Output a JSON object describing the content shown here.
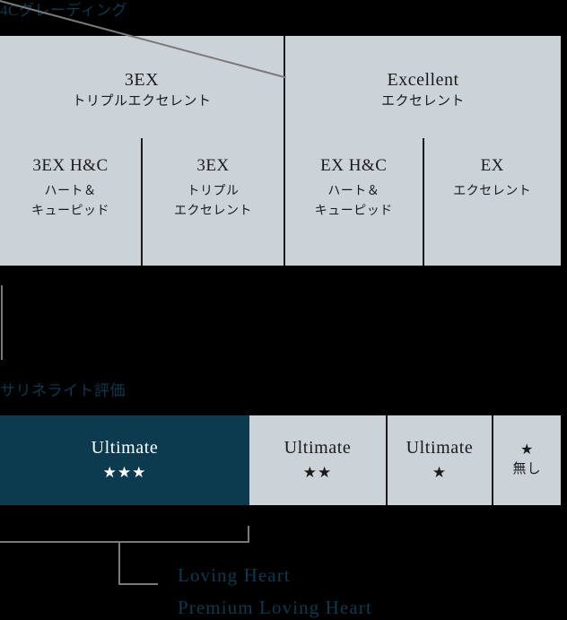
{
  "sections": {
    "grading": {
      "heading": "4Cグレーディング",
      "groups": [
        {
          "en": "3EX",
          "jp": "トリプルエクセレント",
          "cells": [
            {
              "en": "3EX H&C",
              "jp_line1": "ハート＆",
              "jp_line2": "キューピッド"
            },
            {
              "en": "3EX",
              "jp_line1": "トリプル",
              "jp_line2": "エクセレント"
            }
          ]
        },
        {
          "en": "Excellent",
          "jp": "エクセレント",
          "cells": [
            {
              "en": "EX H&C",
              "jp_line1": "ハート＆",
              "jp_line2": "キューピッド"
            },
            {
              "en": "EX",
              "jp_line1": "エクセレント",
              "jp_line2": ""
            }
          ]
        }
      ]
    },
    "sarine": {
      "heading": "サリネライト評価",
      "ratings": [
        {
          "label": "Ultimate",
          "stars": "★★★",
          "highlight": true
        },
        {
          "label": "Ultimate",
          "stars": "★★",
          "highlight": false
        },
        {
          "label": "Ultimate",
          "stars": "★",
          "highlight": false
        },
        {
          "label": "★",
          "stars": "無し",
          "highlight": false
        }
      ]
    },
    "products": {
      "loving_heart": "Loving Heart",
      "premium_loving_heart": "Premium Loving Heart"
    }
  },
  "colors": {
    "accent_teal": "#0d3a4f",
    "panel_gray": "#ccd3d8",
    "line_gray": "#7a7a7a",
    "background": "#000000"
  }
}
